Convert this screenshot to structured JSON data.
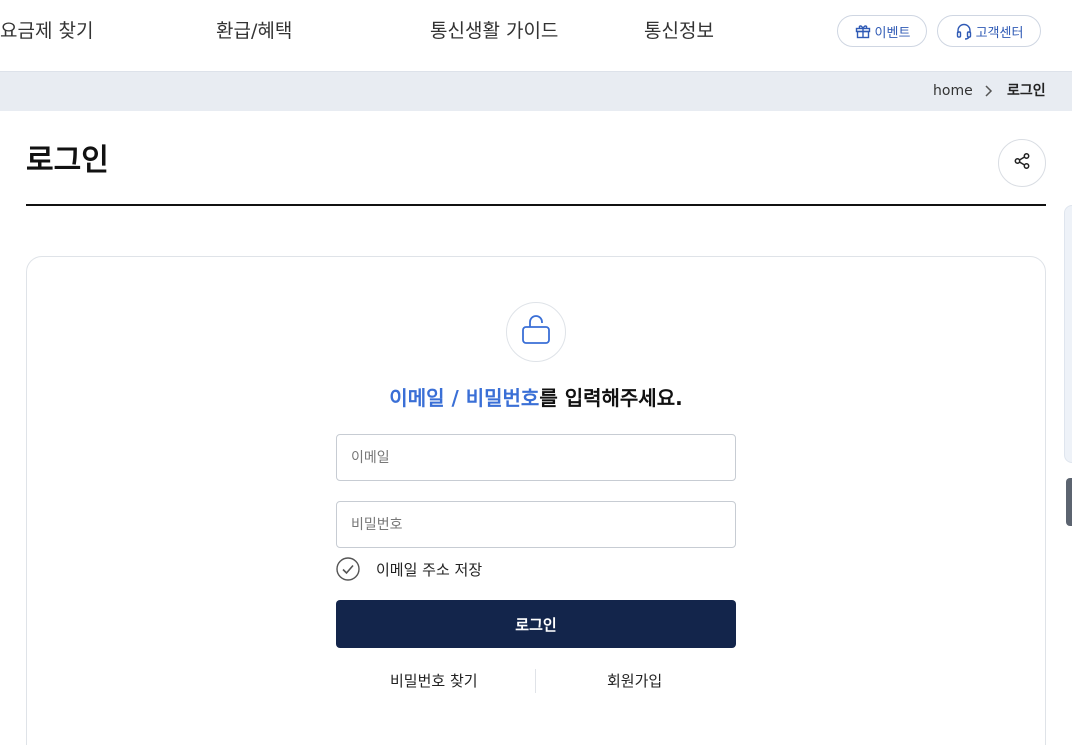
{
  "nav": {
    "items": [
      {
        "label": "요금제 찾기"
      },
      {
        "label": "환급/혜택"
      },
      {
        "label": "통신생활 가이드"
      },
      {
        "label": "통신정보"
      }
    ],
    "event_label": "이벤트",
    "support_label": "고객센터"
  },
  "breadcrumb": {
    "home": "home",
    "current": "로그인"
  },
  "page": {
    "title": "로그인"
  },
  "login": {
    "headline_accent": "이메일 / 비밀번호",
    "headline_rest": "를 입력해주세요.",
    "email_placeholder": "이메일",
    "email_value": "",
    "password_placeholder": "비밀번호",
    "password_value": "",
    "remember_label": "이메일 주소 저장",
    "remember_checked": false,
    "login_button": "로그인",
    "find_password": "비밀번호 찾기",
    "signup": "회원가입"
  },
  "icons": {
    "event": "gift-icon",
    "support": "headset-icon",
    "share": "share-icon",
    "lock": "unlock-icon",
    "check": "check-circle-icon",
    "breadcrumb_separator": "chevron-right-icon"
  },
  "colors": {
    "accent": "#3a6fd6",
    "primary_button": "#13254b",
    "breadcrumb_bar": "#e8ecf2"
  }
}
